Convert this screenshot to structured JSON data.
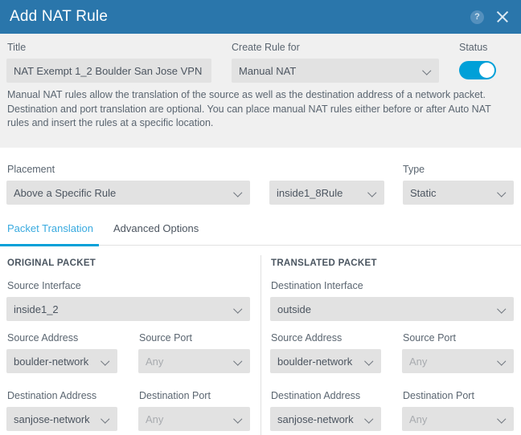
{
  "header": {
    "title": "Add NAT Rule",
    "help_icon": "help-circle-icon",
    "help_glyph": "?",
    "close_icon": "close-icon",
    "background_color": "#2a76ab"
  },
  "top_form": {
    "title_label": "Title",
    "title_value": "NAT Exempt 1_2 Boulder San Jose VPN",
    "create_rule_for_label": "Create Rule for",
    "create_rule_for_value": "Manual NAT",
    "status_label": "Status",
    "status_enabled": true,
    "description": "Manual NAT rules allow the translation of the source as well as the destination address of a network packet. Destination and port translation are optional. You can place manual NAT rules either before or after Auto NAT rules and insert the rules at a specific location."
  },
  "placement_row": {
    "placement_label": "Placement",
    "placement_value": "Above a Specific Rule",
    "specific_rule_value": "inside1_8Rule",
    "type_label": "Type",
    "type_value": "Static"
  },
  "tabs": [
    {
      "label": "Packet Translation",
      "active": true
    },
    {
      "label": "Advanced Options",
      "active": false
    }
  ],
  "original_packet": {
    "section_title": "ORIGINAL PACKET",
    "interface_label": "Source Interface",
    "interface_value": "inside1_2",
    "source_address_label": "Source Address",
    "source_address_value": "boulder-network",
    "source_port_label": "Source Port",
    "source_port_value": "Any",
    "destination_address_label": "Destination Address",
    "destination_address_value": "sanjose-network",
    "destination_port_label": "Destination Port",
    "destination_port_value": "Any"
  },
  "translated_packet": {
    "section_title": "TRANSLATED PACKET",
    "interface_label": "Destination Interface",
    "interface_value": "outside",
    "source_address_label": "Source Address",
    "source_address_value": "boulder-network",
    "source_port_label": "Source Port",
    "source_port_value": "Any",
    "destination_address_label": "Destination Address",
    "destination_address_value": "sanjose-network",
    "destination_port_label": "Destination Port",
    "destination_port_value": "Any"
  },
  "colors": {
    "accent_blue": "#00a0d8",
    "header_blue": "#2a76ab",
    "field_gray": "#e2e2e2",
    "band_gray": "#f0f0f0"
  }
}
